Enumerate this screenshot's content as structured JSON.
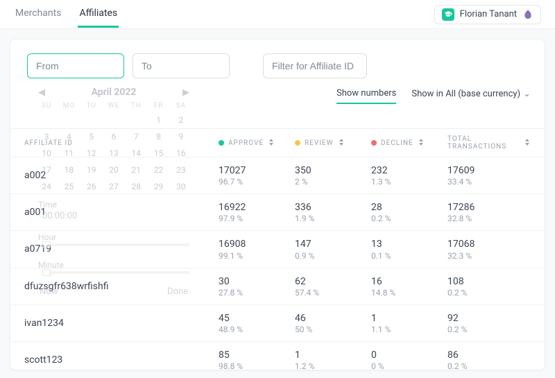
{
  "header": {
    "tabs": {
      "merchants": "Merchants",
      "affiliates": "Affiliates"
    },
    "user_name": "Florian Tanant"
  },
  "filters": {
    "from_placeholder": "From",
    "to_placeholder": "To",
    "affiliate_placeholder": "Filter for Affiliate ID"
  },
  "view_toggles": {
    "show_numbers": "Show numbers",
    "show_currency": "Show in All (base currency)"
  },
  "calendar": {
    "title": "April 2022",
    "weekdays": [
      "SU",
      "MO",
      "TU",
      "WE",
      "TH",
      "FR",
      "SA"
    ],
    "days": [
      "",
      "",
      "",
      "",
      "",
      "1",
      "2",
      "3",
      "4",
      "5",
      "6",
      "7",
      "8",
      "9",
      "10",
      "11",
      "12",
      "13",
      "14",
      "15",
      "16",
      "17",
      "18",
      "19",
      "20",
      "21",
      "22",
      "23",
      "24",
      "25",
      "26",
      "27",
      "28",
      "29",
      "30"
    ],
    "time_label": "Time",
    "time_value": "00:00:00",
    "hour_label": "Hour",
    "minute_label": "Minute",
    "now": "Now",
    "done": "Done"
  },
  "columns": {
    "affiliate_id": "AFFILIATE ID",
    "approve": "APPROVE",
    "review": "REVIEW",
    "decline": "DECLINE",
    "total": "TOTAL TRANSACTIONS"
  },
  "rows": [
    {
      "id": "a002",
      "approve_n": "17027",
      "approve_p": "96.7 %",
      "review_n": "350",
      "review_p": "2 %",
      "decline_n": "232",
      "decline_p": "1.3 %",
      "total_n": "17609",
      "total_p": "33.4 %"
    },
    {
      "id": "a001",
      "approve_n": "16922",
      "approve_p": "97.9 %",
      "review_n": "336",
      "review_p": "1.9 %",
      "decline_n": "28",
      "decline_p": "0.2 %",
      "total_n": "17286",
      "total_p": "32.8 %"
    },
    {
      "id": "a0719",
      "approve_n": "16908",
      "approve_p": "99.1 %",
      "review_n": "147",
      "review_p": "0.9 %",
      "decline_n": "13",
      "decline_p": "0.1 %",
      "total_n": "17068",
      "total_p": "32.3 %"
    },
    {
      "id": "dfuzsgfr638wrfishfi",
      "approve_n": "30",
      "approve_p": "27.8 %",
      "review_n": "62",
      "review_p": "57.4 %",
      "decline_n": "16",
      "decline_p": "14.8 %",
      "total_n": "108",
      "total_p": "0.2 %"
    },
    {
      "id": "ivan1234",
      "approve_n": "45",
      "approve_p": "48.9 %",
      "review_n": "46",
      "review_p": "50 %",
      "decline_n": "1",
      "decline_p": "1.1 %",
      "total_n": "92",
      "total_p": "0.2 %"
    },
    {
      "id": "scott123",
      "approve_n": "85",
      "approve_p": "98.8 %",
      "review_n": "1",
      "review_p": "1.2 %",
      "decline_n": "0",
      "decline_p": "0 %",
      "total_n": "86",
      "total_p": "0.2 %"
    }
  ],
  "colors": {
    "accent": "#16c79a",
    "approve": "#16c79a",
    "review": "#f5c84c",
    "decline": "#ef6f6f"
  }
}
